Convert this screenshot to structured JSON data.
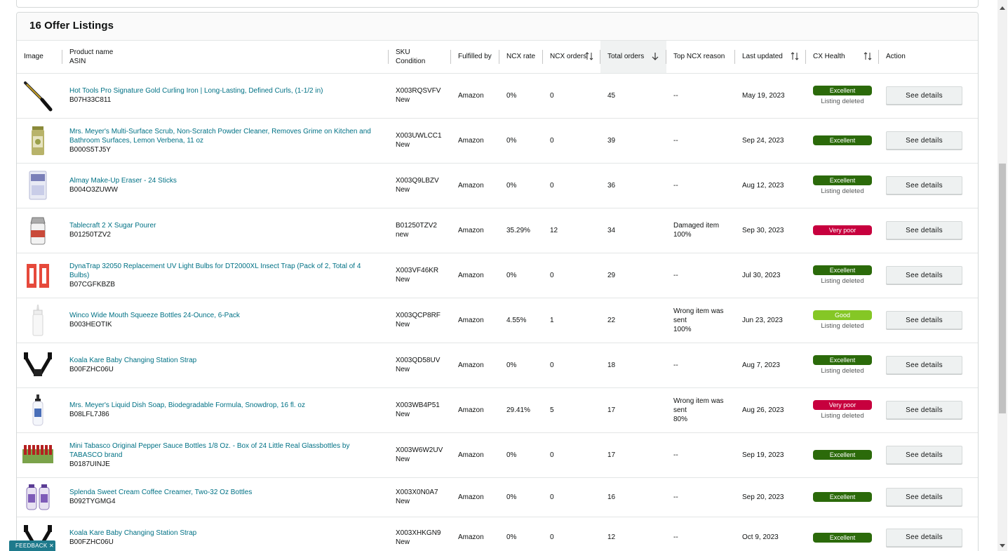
{
  "section_title": "16 Offer Listings",
  "columns": {
    "image": "Image",
    "product_name": "Product name",
    "asin": "ASIN",
    "sku": "SKU",
    "condition": "Condition",
    "fulfilled_by": "Fulfilled by",
    "ncx_rate": "NCX rate",
    "ncx_orders": "NCX orders",
    "total_orders": "Total orders",
    "top_ncx_reason": "Top NCX reason",
    "last_updated": "Last updated",
    "cx_health": "CX Health",
    "action": "Action"
  },
  "rows": [
    {
      "thumb": "curling-iron",
      "name": "Hot Tools Pro Signature Gold Curling Iron | Long-Lasting, Defined Curls, (1-1/2 in)",
      "asin": "B07H33C811",
      "sku": "X003RQSVFV",
      "condition": "New",
      "fulfilled_by": "Amazon",
      "ncx_rate": "0%",
      "ncx_orders": "0",
      "total_orders": "45",
      "reason": "--",
      "reason_pct": "",
      "last_updated": "May 19, 2023",
      "health": "Excellent",
      "health_status": "excellent",
      "health_sub": "Listing deleted",
      "action": "See details"
    },
    {
      "thumb": "scrub-can",
      "name": "Mrs. Meyer's Multi-Surface Scrub, Non-Scratch Powder Cleaner, Removes Grime on Kitchen and Bathroom Surfaces, Lemon Verbena, 11 oz",
      "asin": "B000S5TJ5Y",
      "sku": "X003UWLCC1",
      "condition": "New",
      "fulfilled_by": "Amazon",
      "ncx_rate": "0%",
      "ncx_orders": "0",
      "total_orders": "39",
      "reason": "--",
      "reason_pct": "",
      "last_updated": "Sep 24, 2023",
      "health": "Excellent",
      "health_status": "excellent",
      "health_sub": "",
      "action": "See details"
    },
    {
      "thumb": "makeup-eraser",
      "name": "Almay Make-Up Eraser - 24 Sticks",
      "asin": "B004O3ZUWW",
      "sku": "X003Q9LBZV",
      "condition": "New",
      "fulfilled_by": "Amazon",
      "ncx_rate": "0%",
      "ncx_orders": "0",
      "total_orders": "36",
      "reason": "--",
      "reason_pct": "",
      "last_updated": "Aug 12, 2023",
      "health": "Excellent",
      "health_status": "excellent",
      "health_sub": "Listing deleted",
      "action": "See details"
    },
    {
      "thumb": "sugar-pourer",
      "name": "Tablecraft 2 X Sugar Pourer",
      "asin": "B01250TZV2",
      "sku": "B01250TZV2",
      "condition": "new",
      "fulfilled_by": "Amazon",
      "ncx_rate": "35.29%",
      "ncx_orders": "12",
      "total_orders": "34",
      "reason": "Damaged item",
      "reason_pct": "100%",
      "last_updated": "Sep 30, 2023",
      "health": "Very poor",
      "health_status": "verypoor",
      "health_sub": "",
      "action": "See details"
    },
    {
      "thumb": "uv-bulbs",
      "name": "DynaTrap 32050 Replacement UV Light Bulbs for DT2000XL Insect Trap (Pack of 2, Total of 4 Bulbs)",
      "asin": "B07CGFKBZB",
      "sku": "X003VF46KR",
      "condition": "New",
      "fulfilled_by": "Amazon",
      "ncx_rate": "0%",
      "ncx_orders": "0",
      "total_orders": "29",
      "reason": "--",
      "reason_pct": "",
      "last_updated": "Jul 30, 2023",
      "health": "Excellent",
      "health_status": "excellent",
      "health_sub": "Listing deleted",
      "action": "See details"
    },
    {
      "thumb": "squeeze-bottle",
      "name": "Winco Wide Mouth Squeeze Bottles 24-Ounce, 6-Pack",
      "asin": "B003HEOTIK",
      "sku": "X003QCP8RF",
      "condition": "New",
      "fulfilled_by": "Amazon",
      "ncx_rate": "4.55%",
      "ncx_orders": "1",
      "total_orders": "22",
      "reason": "Wrong item was sent",
      "reason_pct": "100%",
      "last_updated": "Jun 23, 2023",
      "health": "Good",
      "health_status": "good",
      "health_sub": "Listing deleted",
      "action": "See details"
    },
    {
      "thumb": "strap",
      "name": "Koala Kare Baby Changing Station Strap",
      "asin": "B00FZHC06U",
      "sku": "X003QD58UV",
      "condition": "New",
      "fulfilled_by": "Amazon",
      "ncx_rate": "0%",
      "ncx_orders": "0",
      "total_orders": "18",
      "reason": "--",
      "reason_pct": "",
      "last_updated": "Aug 7, 2023",
      "health": "Excellent",
      "health_status": "excellent",
      "health_sub": "Listing deleted",
      "action": "See details"
    },
    {
      "thumb": "soap-bottle",
      "name": "Mrs. Meyer's Liquid Dish Soap, Biodegradable Formula, Snowdrop, 16 fl. oz",
      "asin": "B08LFL7J86",
      "sku": "X003WB4P51",
      "condition": "New",
      "fulfilled_by": "Amazon",
      "ncx_rate": "29.41%",
      "ncx_orders": "5",
      "total_orders": "17",
      "reason": "Wrong item was sent",
      "reason_pct": "80%",
      "last_updated": "Aug 26, 2023",
      "health": "Very poor",
      "health_status": "verypoor",
      "health_sub": "Listing deleted",
      "action": "See details"
    },
    {
      "thumb": "tabasco-box",
      "name": "Mini Tabasco Original Pepper Sauce Bottles 1/8 Oz. - Box of 24 Little Real Glassbottles by TABASCO brand",
      "asin": "B0187UINJE",
      "sku": "X003W6W2UV",
      "condition": "New",
      "fulfilled_by": "Amazon",
      "ncx_rate": "0%",
      "ncx_orders": "0",
      "total_orders": "17",
      "reason": "--",
      "reason_pct": "",
      "last_updated": "Sep 19, 2023",
      "health": "Excellent",
      "health_status": "excellent",
      "health_sub": "",
      "action": "See details"
    },
    {
      "thumb": "creamer-bottles",
      "name": "Splenda Sweet Cream Coffee Creamer, Two-32 Oz Bottles",
      "asin": "B092TYGMG4",
      "sku": "X003X0N0A7",
      "condition": "New",
      "fulfilled_by": "Amazon",
      "ncx_rate": "0%",
      "ncx_orders": "0",
      "total_orders": "16",
      "reason": "--",
      "reason_pct": "",
      "last_updated": "Sep 20, 2023",
      "health": "Excellent",
      "health_status": "excellent",
      "health_sub": "",
      "action": "See details"
    },
    {
      "thumb": "strap",
      "name": "Koala Kare Baby Changing Station Strap",
      "asin": "B00FZHC06U",
      "sku": "X003XHKGN9",
      "condition": "New",
      "fulfilled_by": "Amazon",
      "ncx_rate": "0%",
      "ncx_orders": "0",
      "total_orders": "12",
      "reason": "--",
      "reason_pct": "",
      "last_updated": "Oct 9, 2023",
      "health": "Excellent",
      "health_status": "excellent",
      "health_sub": "",
      "action": "See details"
    }
  ],
  "feedback_label": "FEEDBACK ✕"
}
